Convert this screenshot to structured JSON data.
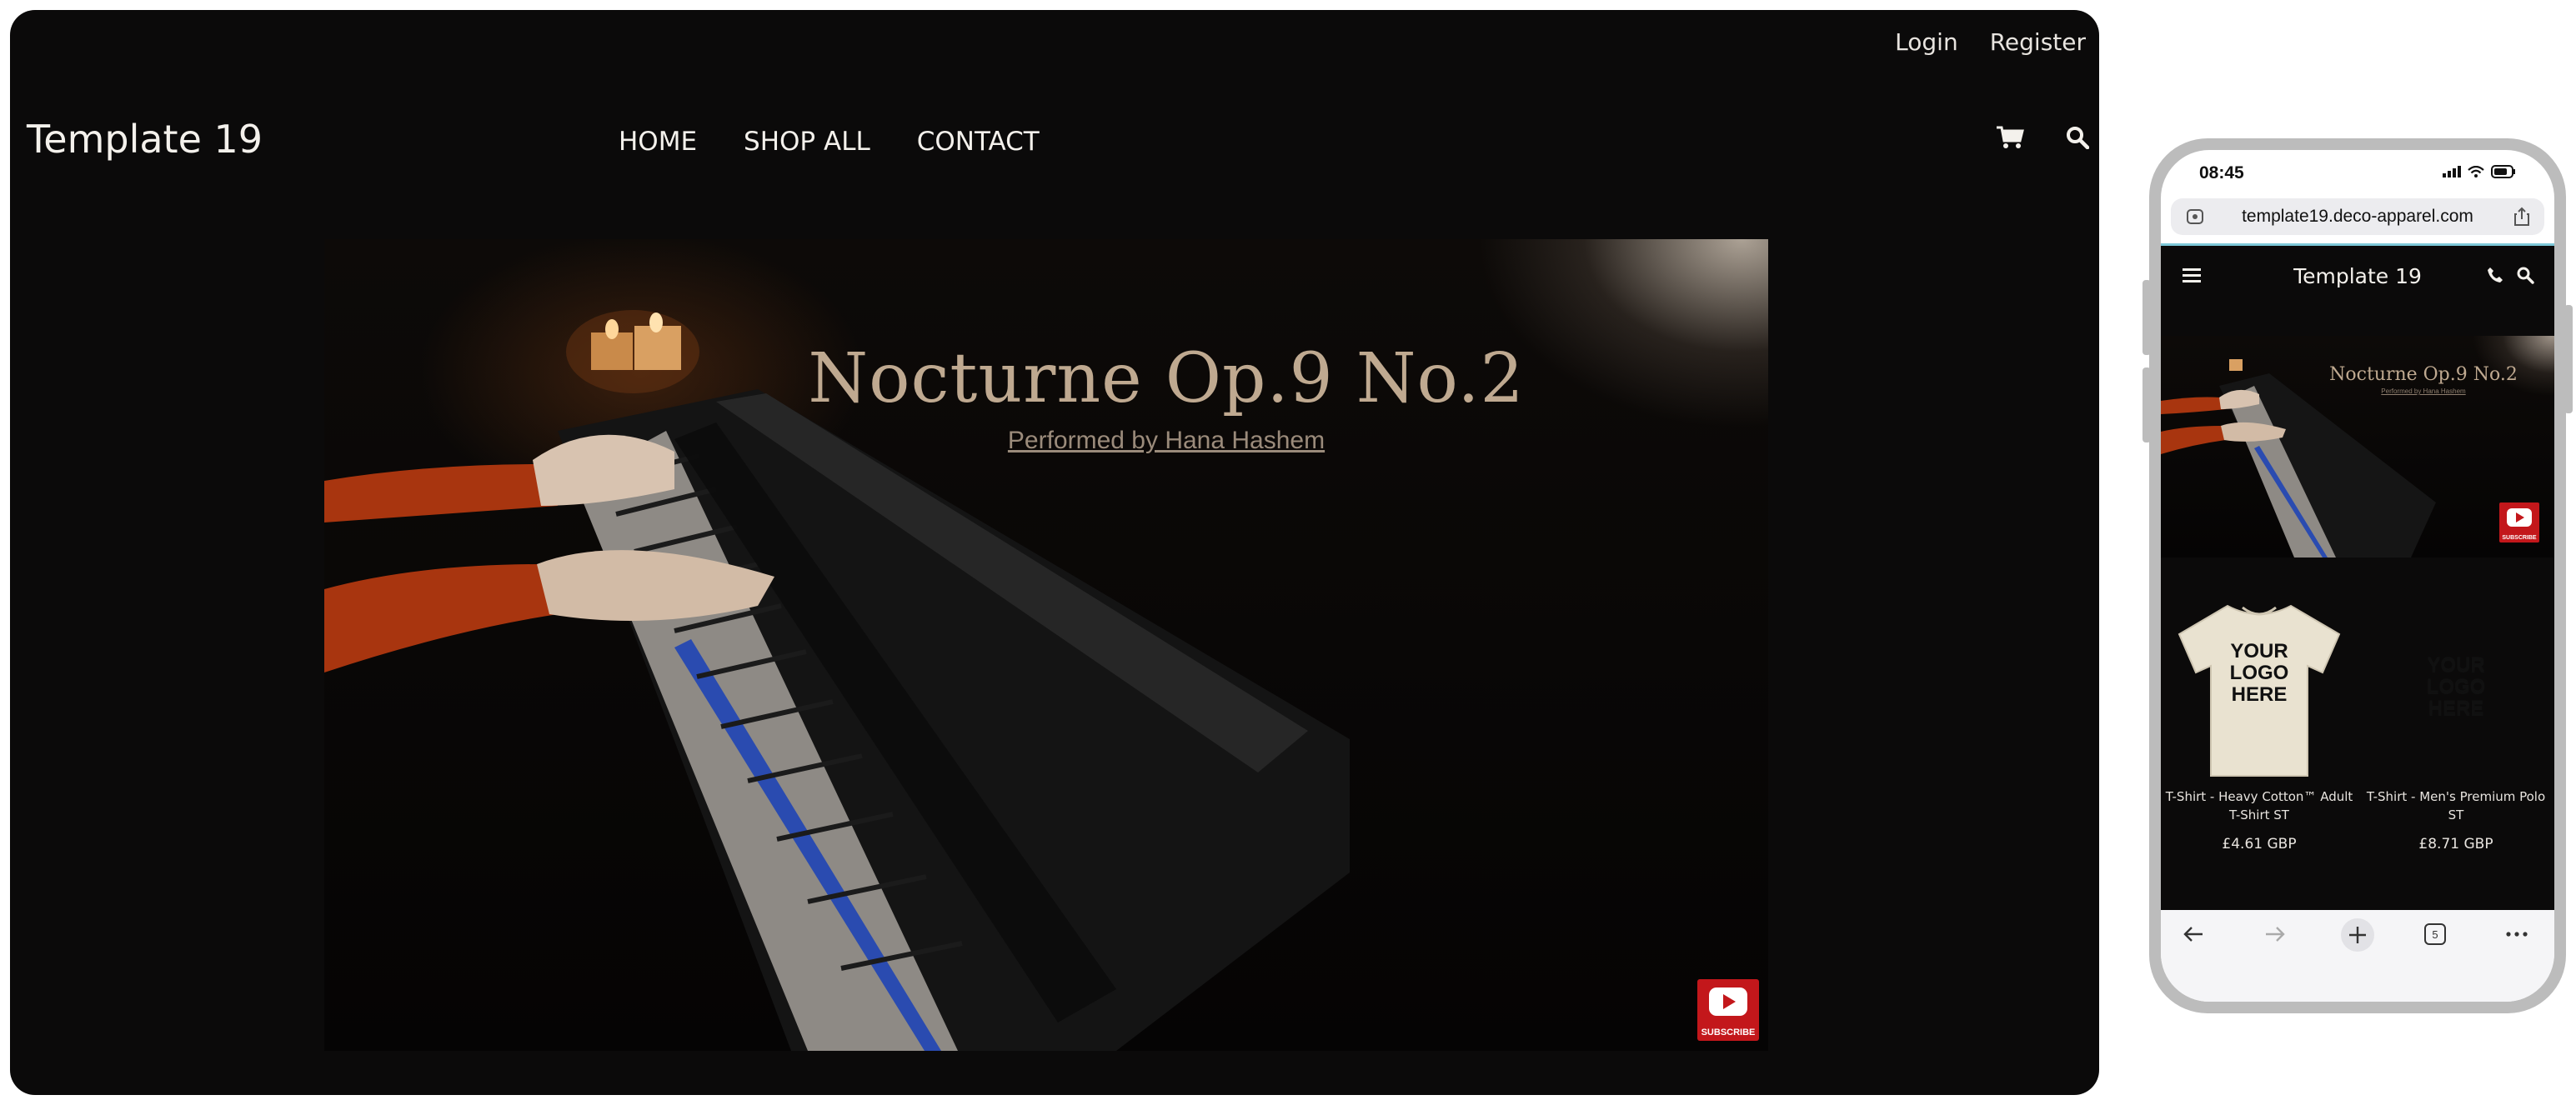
{
  "desktop": {
    "top_links": {
      "login": "Login",
      "register": "Register"
    },
    "brand": "Template 19",
    "nav": [
      {
        "label": "HOME"
      },
      {
        "label": "SHOP ALL"
      },
      {
        "label": "CONTACT"
      }
    ],
    "header_icons": [
      "cart-icon",
      "search-icon"
    ],
    "video": {
      "title": "Nocturne Op.9 No.2",
      "subtitle": "Performed by Hana Hashem",
      "badge_label": "SUBSCRIBE"
    }
  },
  "phone": {
    "status": {
      "time": "08:45"
    },
    "browser": {
      "url": "template19.deco-apparel.com",
      "tab_count": "5"
    },
    "site": {
      "brand": "Template 19",
      "video": {
        "title": "Nocturne Op.9 No.2",
        "subtitle": "Performed by Hana Hashem",
        "badge_label": "SUBSCRIBE"
      },
      "products": [
        {
          "name": "T-Shirt - Heavy Cotton™ Adult T-Shirt ST",
          "price": "£4.61 GBP",
          "shirt_color": "#e9e2d0",
          "print": "YOUR LOGO HERE"
        },
        {
          "name": "T-Shirt - Men's Premium Polo ST",
          "price": "£8.71 GBP",
          "shirt_color": "#b7c3cf",
          "print": "YOUR LOGO HERE"
        }
      ]
    }
  },
  "colors": {
    "page_bg": "#0b0a0a",
    "youtube_red": "#c3171b",
    "title_gold": "#bfa990"
  }
}
